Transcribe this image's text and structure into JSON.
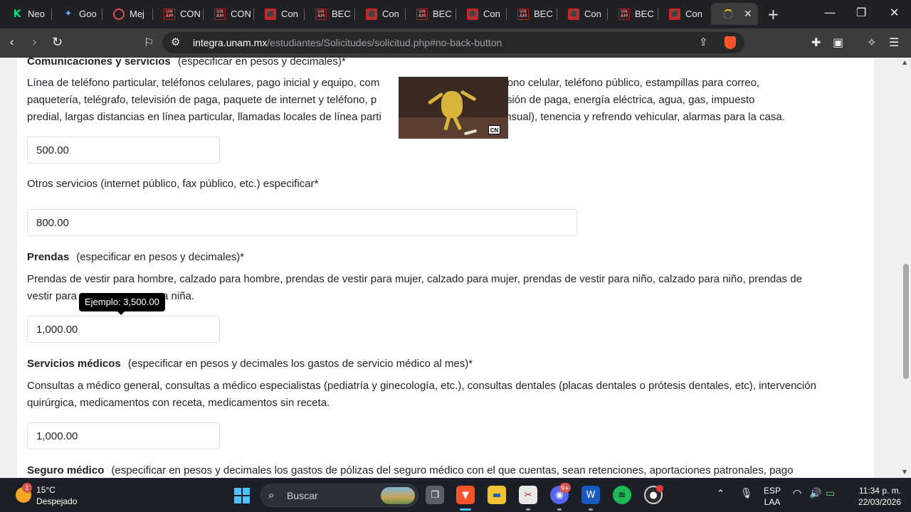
{
  "tabs": [
    {
      "favicon": "kick-logo-icon",
      "title": "Neo"
    },
    {
      "favicon": "gemini-star-icon",
      "title": "Goo"
    },
    {
      "favicon": "circle-logo-icon",
      "title": "Mej"
    },
    {
      "favicon": "unam-logo-icon",
      "title": "CON",
      "favicon_text": "UN AM"
    },
    {
      "favicon": "unam-logo-icon",
      "title": "CON",
      "favicon_text": "UN AM"
    },
    {
      "favicon": "pdf-icon",
      "title": "Con",
      "favicon_text": "PDF"
    },
    {
      "favicon": "unam-logo-icon",
      "title": "BEC",
      "favicon_text": "UN AM"
    },
    {
      "favicon": "pdf-icon",
      "title": "Con",
      "favicon_text": "PDF"
    },
    {
      "favicon": "unam-logo-icon",
      "title": "BEC",
      "favicon_text": "UN AM"
    },
    {
      "favicon": "pdf-icon",
      "title": "Con",
      "favicon_text": "PDF"
    },
    {
      "favicon": "unam-logo-icon",
      "title": "BEC",
      "favicon_text": "UN AM"
    },
    {
      "favicon": "pdf-icon",
      "title": "Con",
      "favicon_text": "PDF"
    },
    {
      "favicon": "unam-logo-icon",
      "title": "BEC",
      "favicon_text": "UN AM"
    },
    {
      "favicon": "pdf-icon",
      "title": "Con",
      "favicon_text": "PDF"
    }
  ],
  "active_tab": {
    "favicon": "loading-spinner-icon",
    "close": "✕"
  },
  "window_controls": {
    "minimize": "—",
    "maximize": "❐",
    "close": "✕"
  },
  "toolbar": {
    "url_host": "integra.unam.mx",
    "url_path": "/estudiantes/Solicitudes/solicitud.php#no-back-button"
  },
  "form": {
    "comunicaciones": {
      "title": "Comunicaciones y servicios",
      "hint": "(especificar en pesos y decimales)*",
      "description_before": "Línea de teléfono particular, teléfonos celulares, pago inicial y equipo, com",
      "description_line1_after": "rvicio de teléfono celular, teléfono público, estampillas para correo,",
      "description_line2_before": "paquetería, telégrafo, televisión de paga, paquete de internet y teléfono, p",
      "description_line2_after": "léfono y televisión de paga, energía eléctrica, agua, gas, impuesto",
      "description_line3_before": "predial, largas distancias en línea particular, llamadas locales de línea parti",
      "description_line3_after": "res (plan mensual), tenencia y refrendo vehicular, alarmas para la casa.",
      "value": "500.00"
    },
    "otros_servicios": {
      "label": "Otros servicios (internet público, fax público, etc.) especificar*",
      "value": "800.00"
    },
    "prendas": {
      "title": "Prendas",
      "hint": "(especificar en pesos y decimales)*",
      "description_line1": "Prendas de vestir para hombre, calzado para hombre, prendas de vestir para mujer, calzado para mujer, prendas de vestir para niño, calzado para niño, prendas de",
      "description_line2_before": "vestir para",
      "description_line2_after": "a niña.",
      "value": "1,000.00",
      "tooltip": "Ejemplo: 3,500.00"
    },
    "servicios_medicos": {
      "title": "Servicios médicos",
      "hint": "(especificar en pesos y decimales los gastos de servicio médico al mes)*",
      "description": "Consultas a médico general, consultas a médico especialistas (pediatría y ginecología, etc.), consultas dentales (placas dentales o prótesis dentales, etc), intervención quirúrgica, medicamentos con receta, medicamentos sin receta.",
      "value": "1,000.00"
    },
    "seguro_medico": {
      "title": "Seguro médico",
      "hint": "(especificar en pesos y decimales los gastos de pólizas del seguro médico con el que cuentas, sean retenciones, aportaciones patronales, pago"
    }
  },
  "gif_overlay": {
    "badge": "CN"
  },
  "taskbar": {
    "weather_temp": "15°C",
    "weather_desc": "Despejado",
    "weather_badge": "1",
    "search_placeholder": "Buscar",
    "discord_badge": "9+",
    "language_line1": "ESP",
    "language_line2": "LAA",
    "time": "11:34 p. m.",
    "date": "22/03/2026"
  }
}
